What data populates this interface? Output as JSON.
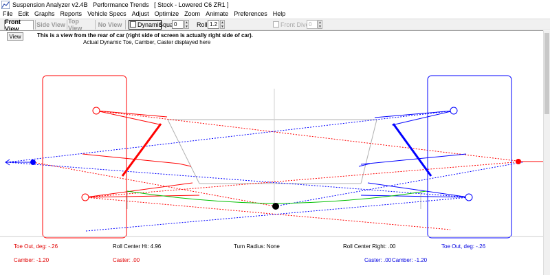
{
  "window": {
    "title": "Suspension Analyzer v2.4B   Performance Trends   [ Stock - Lowered C6 ZR1 ]"
  },
  "menu": [
    "File",
    "Edit",
    "Graphs",
    "Reports",
    "Vehicle Specs",
    "Adjust",
    "Optimize",
    "Zoom",
    "Animate",
    "Preferences",
    "Help"
  ],
  "toolbar": {
    "tabs": [
      "Front View",
      "Side View",
      "Top View",
      "No View"
    ],
    "dynamic_label": "Dynamic",
    "squat_label": "Squat",
    "squat_value": "0",
    "roll_label": "Roll",
    "roll_value": "1.2",
    "front_dive_label": "Front Dive",
    "front_dive_value": "0"
  },
  "canvas": {
    "view_button": "View",
    "info_line_1": "This is a view from the rear of car (right side of screen is actually right side of car).",
    "info_line_2": "Actual Dynamic Toe, Camber, Caster displayed here"
  },
  "readouts": {
    "left_toe": "Toe Out, deg: -.26",
    "left_camber": "Camber: -1.20",
    "roll_center_ht": "Roll Center Ht: 4.96",
    "left_caster": "Caster: .00",
    "turn_radius": "Turn Radius: None",
    "roll_center_right": "Roll Center Right: .00",
    "right_caster": "Caster: .00",
    "right_camber": "Camber: -1.20",
    "right_toe": "Toe Out, deg: -.26"
  },
  "colors": {
    "left_side": "#ff0000",
    "right_side": "#0000ff",
    "roll_center": "#000000",
    "track_line": "#00c000",
    "chassis": "#b0b0b0"
  }
}
